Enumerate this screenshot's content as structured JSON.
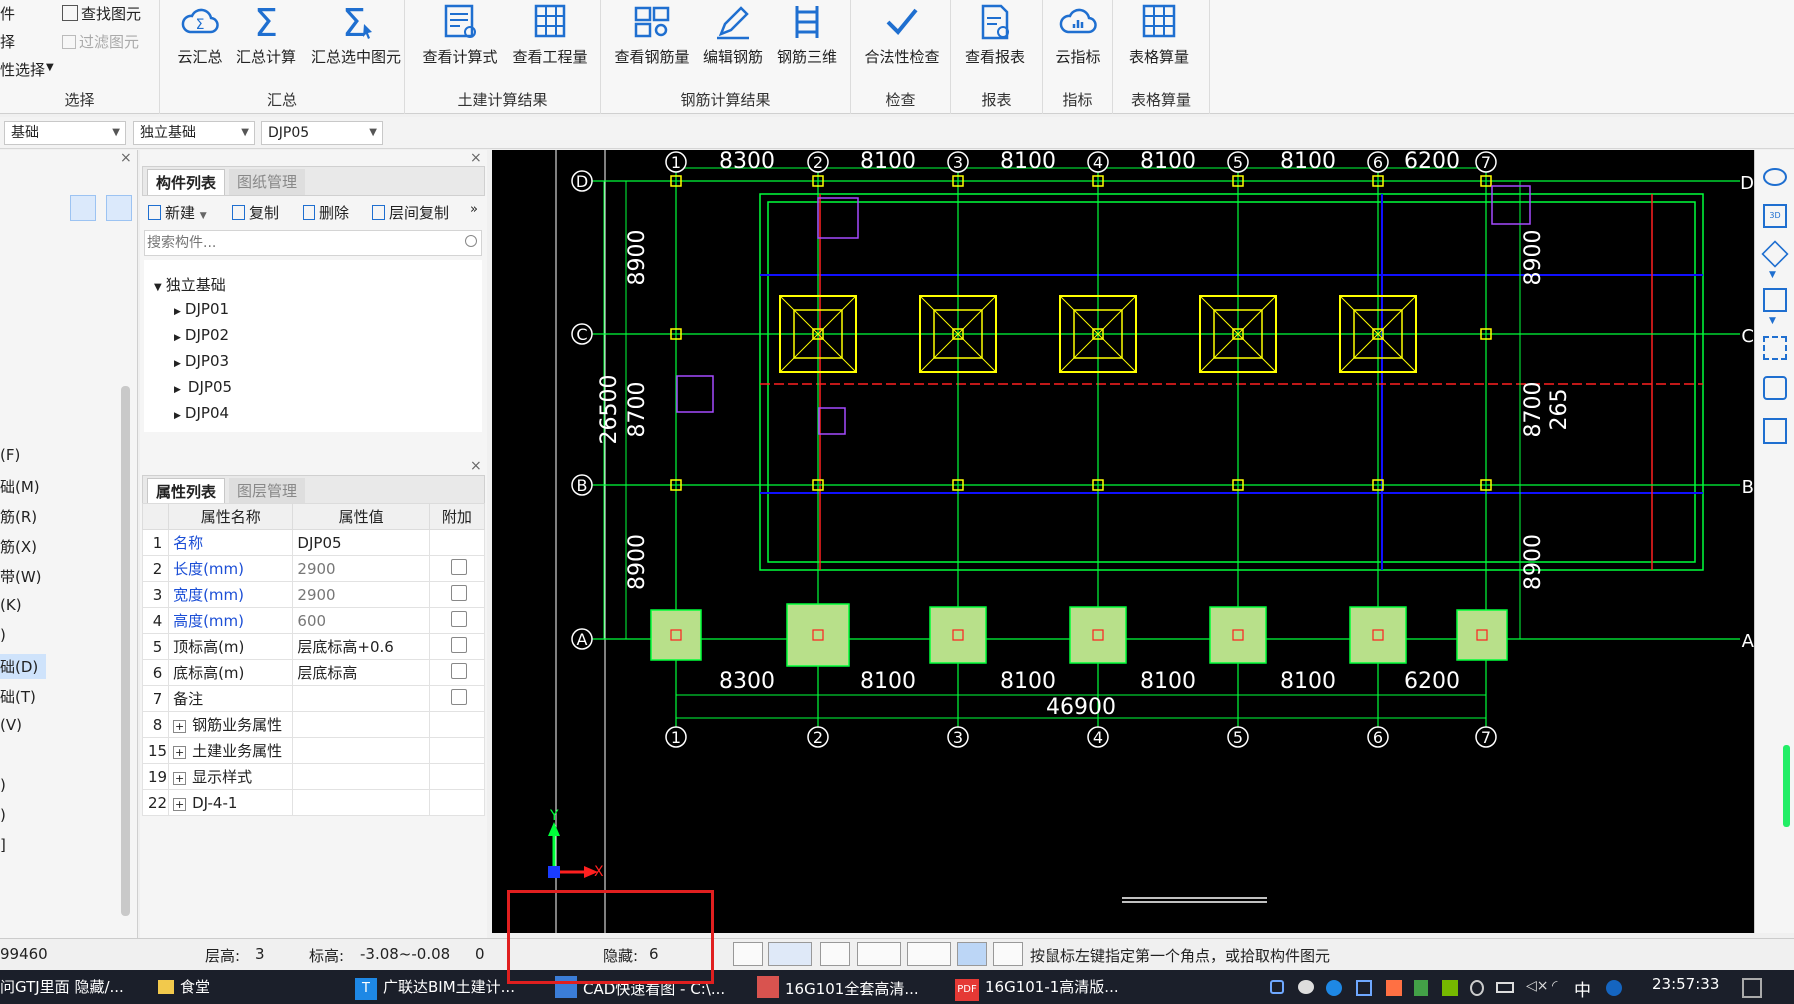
{
  "ribbon": {
    "select_group": {
      "label": "选择",
      "items": [
        "件",
        "择",
        "性选择"
      ],
      "find": "查找图元",
      "filter": "过滤图元"
    },
    "groups": [
      {
        "label": "汇总",
        "buttons": [
          "云汇总",
          "汇总计算",
          "汇总选中图元"
        ]
      },
      {
        "label": "土建计算结果",
        "buttons": [
          "查看计算式",
          "查看工程量"
        ]
      },
      {
        "label": "钢筋计算结果",
        "buttons": [
          "查看钢筋量",
          "编辑钢筋",
          "钢筋三维"
        ]
      },
      {
        "label": "检查",
        "buttons": [
          "合法性检查"
        ]
      },
      {
        "label": "报表",
        "buttons": [
          "查看报表"
        ]
      },
      {
        "label": "指标",
        "buttons": [
          "云指标"
        ]
      },
      {
        "label": "表格算量",
        "buttons": [
          "表格算量"
        ]
      }
    ]
  },
  "selectors": [
    "基础",
    "独立基础",
    "DJP05"
  ],
  "left_nav": [
    "(F)",
    "础(M)",
    "筋(R)",
    "筋(X)",
    "带(W)",
    "(K)",
    ")",
    "础(D)",
    "础(T)",
    "(V)",
    ")",
    ")",
    "]"
  ],
  "component_panel": {
    "tabs": [
      "构件列表",
      "图纸管理"
    ],
    "toolbar": [
      "新建",
      "复制",
      "删除",
      "层间复制"
    ],
    "search_placeholder": "搜索构件...",
    "tree_root": "独立基础",
    "tree_items": [
      "DJP01",
      "DJP02",
      "DJP03",
      "DJP05",
      "DJP04"
    ]
  },
  "property_panel": {
    "tabs": [
      "属性列表",
      "图层管理"
    ],
    "headers": [
      "属性名称",
      "属性值",
      "附加"
    ],
    "rows": [
      {
        "n": "1",
        "name": "名称",
        "value": "DJP05"
      },
      {
        "n": "2",
        "name": "长度(mm)",
        "value": "2900"
      },
      {
        "n": "3",
        "name": "宽度(mm)",
        "value": "2900"
      },
      {
        "n": "4",
        "name": "高度(mm)",
        "value": "600"
      },
      {
        "n": "5",
        "name": "顶标高(m)",
        "value": "层底标高+0.6"
      },
      {
        "n": "6",
        "name": "底标高(m)",
        "value": "层底标高"
      },
      {
        "n": "7",
        "name": "备注",
        "value": ""
      },
      {
        "n": "8",
        "name": "钢筋业务属性",
        "value": ""
      },
      {
        "n": "15",
        "name": "土建业务属性",
        "value": ""
      },
      {
        "n": "19",
        "name": "显示样式",
        "value": ""
      },
      {
        "n": "22",
        "name": "DJ-4-1",
        "value": ""
      }
    ]
  },
  "drawing": {
    "top_dims": [
      "8300",
      "8100",
      "8100",
      "8100",
      "8100",
      "6200"
    ],
    "bottom_dims": [
      "8300",
      "8100",
      "8100",
      "8100",
      "8100",
      "6200"
    ],
    "total_dim": "46900",
    "axes_num": [
      "1",
      "2",
      "3",
      "4",
      "5",
      "6",
      "7"
    ],
    "axes_letter": [
      "D",
      "C",
      "B",
      "A"
    ],
    "left_dims": [
      "8900",
      "8700",
      "8900"
    ],
    "left_total": "26500",
    "right_dims": [
      "8900",
      "8700",
      "8900"
    ],
    "right_total": "265",
    "axis_x": "X",
    "axis_y": "Y",
    "colors": {
      "bg": "#000000",
      "grid": "#00ff3a",
      "red": "#ff2020",
      "yellow": "#ffff00",
      "blue": "#1010ff",
      "pad": "#b8e08a"
    }
  },
  "status": {
    "coord": "99460",
    "floor_label": "层高:",
    "floor_value": "3",
    "elev_label": "标高:",
    "elev_value": "-3.08~-0.08",
    "zero": "0",
    "hidden_label": "隐藏:",
    "hidden_value": "6",
    "hint": "按鼠标左键指定第一个角点，或拾取构件图元"
  },
  "taskbar": {
    "items": [
      "问GTJ里面 隐藏/...",
      "食堂",
      "广联达BIM土建计...",
      "CAD快速看图 - C:\\...",
      "16G101全套高清...",
      "16G101-1高清版..."
    ],
    "clock": "23:57:33",
    "ime": "中"
  }
}
